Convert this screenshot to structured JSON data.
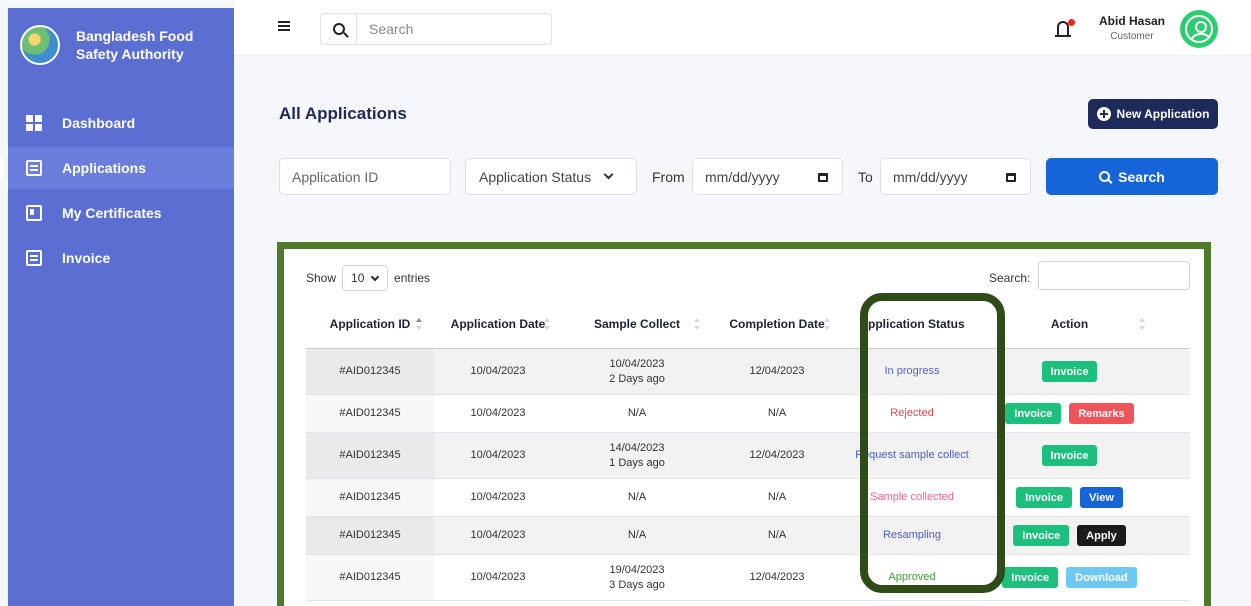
{
  "brand": {
    "name": "Bangladesh Food Safety Authority"
  },
  "sidebar": {
    "items": [
      {
        "label": "Dashboard",
        "icon": "dashboard-icon",
        "active": false
      },
      {
        "label": "Applications",
        "icon": "applications-icon",
        "active": true
      },
      {
        "label": "My Certificates",
        "icon": "certificate-icon",
        "active": false
      },
      {
        "label": "Invoice",
        "icon": "invoice-icon",
        "active": false
      }
    ]
  },
  "topbar": {
    "search_placeholder": "Search",
    "user_name": "Abid Hasan",
    "user_role": "Customer"
  },
  "page": {
    "title": "All Applications",
    "new_button": "New Application"
  },
  "filters": {
    "app_id_placeholder": "Application ID",
    "status_label": "Application Status",
    "from_label": "From",
    "from_value": "mm/dd/yyyy",
    "to_label": "To",
    "to_value": "mm/dd/yyyy",
    "search_button": "Search"
  },
  "table": {
    "show_label": "Show",
    "page_length": "10",
    "entries_label": "entries",
    "search_label": "Search:",
    "columns": [
      "Application ID",
      "Application Date",
      "Sample Collect",
      "Completion Date",
      "Application Status",
      "Action"
    ],
    "rows": [
      {
        "id": "#AID012345",
        "date": "10/04/2023",
        "sample": "10/04/2023",
        "sample_ago": "2 Days ago",
        "completion": "12/04/2023",
        "status": "In progress",
        "status_color": "#5a64c8",
        "actions": [
          {
            "label": "Invoice",
            "color": "#1cc07c"
          }
        ]
      },
      {
        "id": "#AID012345",
        "date": "10/04/2023",
        "sample": "N/A",
        "sample_ago": "",
        "completion": "N/A",
        "status": "Rejected",
        "status_color": "#e5484d",
        "actions": [
          {
            "label": "Invoice",
            "color": "#1cc07c"
          },
          {
            "label": "Remarks",
            "color": "#f0545a"
          }
        ]
      },
      {
        "id": "#AID012345",
        "date": "10/04/2023",
        "sample": "14/04/2023",
        "sample_ago": "1 Days ago",
        "completion": "12/04/2023",
        "status": "Request sample collect",
        "status_color": "#4a5fd0",
        "actions": [
          {
            "label": "Invoice",
            "color": "#1cc07c"
          }
        ]
      },
      {
        "id": "#AID012345",
        "date": "10/04/2023",
        "sample": "N/A",
        "sample_ago": "",
        "completion": "N/A",
        "status": "Sample collected",
        "status_color": "#f06292",
        "actions": [
          {
            "label": "Invoice",
            "color": "#1cc07c"
          },
          {
            "label": "View",
            "color": "#1565d8"
          }
        ]
      },
      {
        "id": "#AID012345",
        "date": "10/04/2023",
        "sample": "N/A",
        "sample_ago": "",
        "completion": "N/A",
        "status": "Resampling",
        "status_color": "#4a5fd0",
        "actions": [
          {
            "label": "Invoice",
            "color": "#1cc07c"
          },
          {
            "label": "Apply",
            "color": "#1b1b1b"
          }
        ]
      },
      {
        "id": "#AID012345",
        "date": "10/04/2023",
        "sample": "19/04/2023",
        "sample_ago": "3 Days ago",
        "completion": "12/04/2023",
        "status": "Approved",
        "status_color": "#3f9a35",
        "actions": [
          {
            "label": "Invoice",
            "color": "#1cc07c"
          },
          {
            "label": "Download",
            "color": "#6dc8f2"
          }
        ]
      }
    ]
  },
  "colors": {
    "sidebar": "#5b6fd3",
    "primary_button": "#1565d8",
    "dark_button": "#1e2a5a",
    "highlight": "#4e7a2c"
  }
}
